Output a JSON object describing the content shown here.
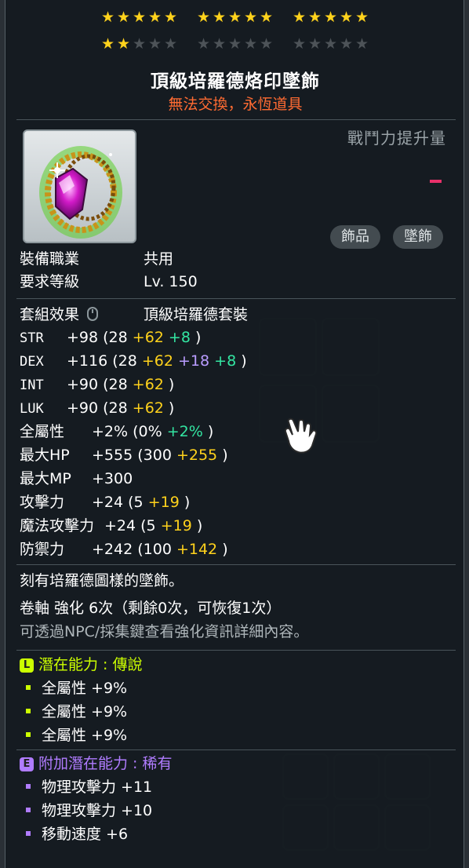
{
  "stars": {
    "row1": [
      5,
      5,
      5
    ],
    "row2": [
      2,
      0,
      0
    ]
  },
  "item": {
    "name": "頂級培羅德烙印墜飾",
    "trade": "無法交換，永恆道具",
    "power_label": "戰鬥力提升量",
    "tags": [
      "飾品",
      "墜飾"
    ],
    "job_label": "裝備職業",
    "job_value": "共用",
    "level_label": "要求等級",
    "level_value": "Lv. 150",
    "set_label": "套組效果",
    "set_value": "頂級培羅德套裝"
  },
  "stats": [
    {
      "name": "STR",
      "total": "+98",
      "open": "(28",
      "parts": [
        [
          "+62",
          "yel"
        ],
        [
          "+8",
          "grn"
        ]
      ]
    },
    {
      "name": "DEX",
      "total": "+116",
      "open": "(28",
      "parts": [
        [
          "+62",
          "yel"
        ],
        [
          "+18",
          "pur"
        ],
        [
          "+8",
          "grn"
        ]
      ]
    },
    {
      "name": "INT",
      "total": "+90",
      "open": "(28",
      "parts": [
        [
          "+62",
          "yel"
        ]
      ]
    },
    {
      "name": "LUK",
      "total": "+90",
      "open": "(28",
      "parts": [
        [
          "+62",
          "yel"
        ]
      ]
    },
    {
      "name": "全屬性",
      "total": "+2%",
      "open": "(0%",
      "parts": [
        [
          "+2%",
          "grn"
        ]
      ]
    },
    {
      "name": "最大HP",
      "total": "+555",
      "open": "(300",
      "parts": [
        [
          "+255",
          "yel"
        ]
      ]
    },
    {
      "name": "最大MP",
      "total": "+300",
      "open": "",
      "parts": []
    },
    {
      "name": "攻擊力",
      "total": "+24",
      "open": "(5",
      "parts": [
        [
          "+19",
          "yel"
        ]
      ]
    },
    {
      "name": "魔法攻擊力",
      "total": "+24",
      "open": "(5",
      "parts": [
        [
          "+19",
          "yel"
        ]
      ]
    },
    {
      "name": "防禦力",
      "total": "+242",
      "open": "(100",
      "parts": [
        [
          "+142",
          "yel"
        ]
      ]
    }
  ],
  "description": "刻有培羅德圖樣的墜飾。",
  "upgrade": "卷軸 強化 6次（剩餘0次，可恢復1次）",
  "upgrade_hint": "可透過NPC/採集鍵查看強化資訊詳細內容。",
  "potential": {
    "badge": "L",
    "label": "潛在能力 : 傳說",
    "lines": [
      "全屬性  +9%",
      "全屬性  +9%",
      "全屬性  +9%"
    ]
  },
  "bonus_potential": {
    "badge": "E",
    "label": "附加潛在能力 : 稀有",
    "lines": [
      "物理攻擊力  +11",
      "物理攻擊力  +10",
      "移動速度  +6"
    ]
  },
  "colors": {
    "legendary": "#ccff00",
    "epic": "#b07cff",
    "orange": "#ff6b32",
    "gold": "#ffd21c",
    "green": "#33e6a2"
  }
}
